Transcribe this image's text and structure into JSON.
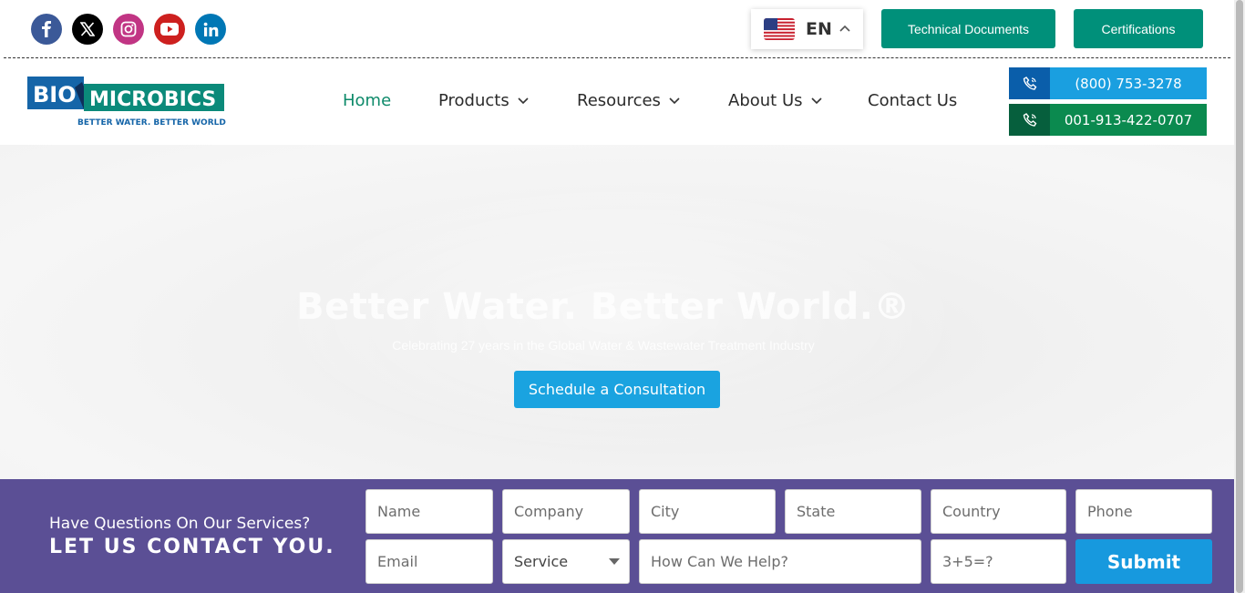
{
  "socials": [
    {
      "name": "facebook-icon",
      "glyph": "f"
    },
    {
      "name": "x-twitter-icon",
      "glyph": "X"
    },
    {
      "name": "instagram-icon",
      "glyph": ""
    },
    {
      "name": "youtube-icon",
      "glyph": ""
    },
    {
      "name": "linkedin-icon",
      "glyph": "in"
    }
  ],
  "language": {
    "code": "EN",
    "flag": "us-flag-icon"
  },
  "top_buttons": {
    "docs": "Technical Documents",
    "certs": "Certifications"
  },
  "logo": {
    "brand_left": "BIO",
    "brand_right": "MICROBICS",
    "tagline": "BETTER WATER. BETTER WORLD."
  },
  "nav": [
    {
      "label": "Home",
      "active": true,
      "dropdown": false
    },
    {
      "label": "Products",
      "active": false,
      "dropdown": true
    },
    {
      "label": "Resources",
      "active": false,
      "dropdown": true
    },
    {
      "label": "About Us",
      "active": false,
      "dropdown": true
    },
    {
      "label": "Contact Us",
      "active": false,
      "dropdown": false
    }
  ],
  "phones": {
    "primary": "(800) 753-3278",
    "international": "001-913-422-0707"
  },
  "hero": {
    "title": "Better Water. Better World.®",
    "subtitle": "Celebrating 27 years in the Global Water & Wastewater Treatment Industry",
    "cta": "Schedule a Consultation"
  },
  "contact": {
    "question": "Have Questions On Our Services?",
    "call_to_action": "LET US CONTACT YOU.",
    "placeholders": {
      "name": "Name",
      "company": "Company",
      "city": "City",
      "state": "State",
      "country": "Country",
      "phone": "Phone",
      "email": "Email",
      "help": "How Can We Help?",
      "captcha": "3+5=?"
    },
    "service_selected": "Service",
    "submit": "Submit"
  },
  "colors": {
    "primary_green": "#00907a",
    "nav_active": "#0e8a6a",
    "blue": "#1aa3e0",
    "contact_band": "#5b4f95"
  }
}
